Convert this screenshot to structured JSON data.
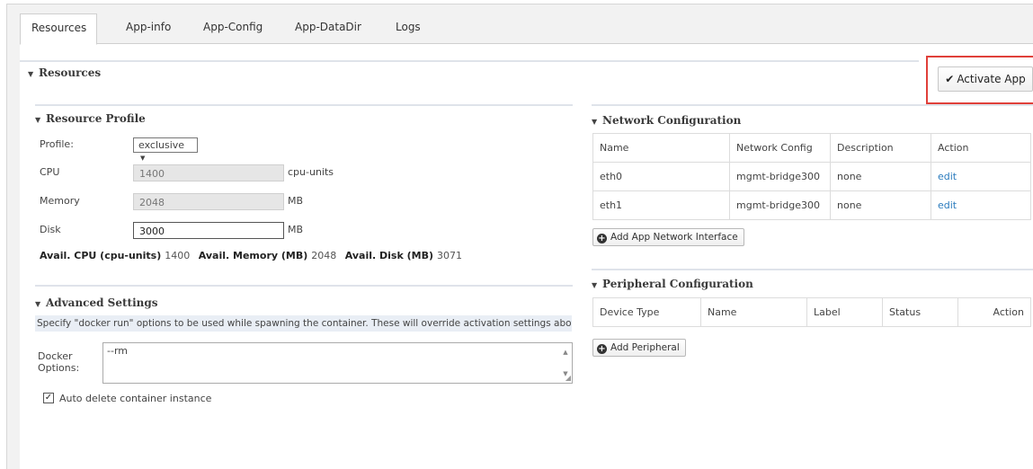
{
  "tabs": [
    {
      "label": "Resources"
    },
    {
      "label": "App-info"
    },
    {
      "label": "App-Config"
    },
    {
      "label": "App-DataDir"
    },
    {
      "label": "Logs"
    }
  ],
  "resources": {
    "title": "Resources",
    "activate_label": "Activate App",
    "profile": {
      "title": "Resource Profile",
      "profile_label": "Profile:",
      "profile_value": "exclusive",
      "cpu_label": "CPU",
      "cpu_value": "1400",
      "cpu_unit": "cpu-units",
      "memory_label": "Memory",
      "memory_value": "2048",
      "memory_unit": "MB",
      "disk_label": "Disk",
      "disk_value": "3000",
      "disk_unit": "MB",
      "avail_cpu_label": "Avail. CPU (cpu-units)",
      "avail_cpu_value": "1400",
      "avail_mem_label": "Avail. Memory (MB)",
      "avail_mem_value": "2048",
      "avail_disk_label": "Avail. Disk (MB)",
      "avail_disk_value": "3071"
    },
    "advanced": {
      "title": "Advanced Settings",
      "note": "Specify \"docker run\" options to be used while spawning the container. These will override activation settings above.",
      "docker_label_1": "Docker",
      "docker_label_2": "Options:",
      "docker_value": "--rm",
      "auto_delete_label": "Auto delete container instance",
      "auto_delete_checked": true
    },
    "network": {
      "title": "Network Configuration",
      "headers": [
        "Name",
        "Network Config",
        "Description",
        "Action"
      ],
      "rows": [
        {
          "name": "eth0",
          "config": "mgmt-bridge300",
          "description": "none",
          "action": "edit"
        },
        {
          "name": "eth1",
          "config": "mgmt-bridge300",
          "description": "none",
          "action": "edit"
        }
      ],
      "add_label": "Add App Network Interface"
    },
    "peripheral": {
      "title": "Peripheral Configuration",
      "headers": [
        "Device Type",
        "Name",
        "Label",
        "Status",
        "Action"
      ],
      "add_label": "Add Peripheral"
    }
  }
}
